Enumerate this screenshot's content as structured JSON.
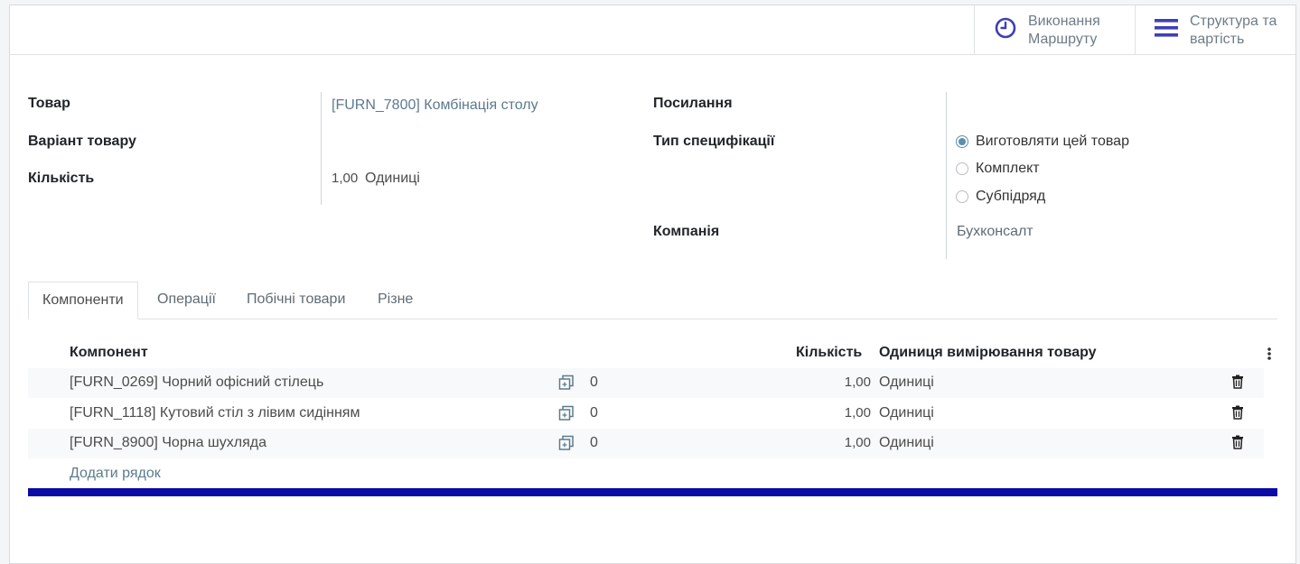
{
  "buttons": {
    "routing": {
      "label": "Виконання\nМаршруту",
      "icon": "clock-icon"
    },
    "structure": {
      "label": "Структура та\nвартість",
      "icon": "bars-icon"
    }
  },
  "fields": {
    "product": {
      "label": "Товар",
      "value": "[FURN_7800] Комбінація столу"
    },
    "variant": {
      "label": "Варіант товару",
      "value": ""
    },
    "quantity": {
      "label": "Кількість",
      "value": "1,00",
      "uom": "Одиниці"
    },
    "reference": {
      "label": "Посилання",
      "value": ""
    },
    "bom_type": {
      "label": "Тип специфікації",
      "options": [
        "Виготовляти цей товар",
        "Комплект",
        "Субпідряд"
      ],
      "selected": "Виготовляти цей товар"
    },
    "company": {
      "label": "Компанія",
      "value": "Бухконсалт"
    }
  },
  "tabs": [
    "Компоненти",
    "Операції",
    "Побічні товари",
    "Різне"
  ],
  "active_tab": "Компоненти",
  "table": {
    "columns": [
      "Компонент",
      "Кількість",
      "Одиниця вимірювання товару"
    ],
    "rows": [
      {
        "component": "[FURN_0269] Чорний офісний стілець",
        "count": "0",
        "qty": "1,00",
        "uom": "Одиниці"
      },
      {
        "component": "[FURN_1118] Кутовий стіл з лівим сидінням",
        "count": "0",
        "qty": "1,00",
        "uom": "Одиниці"
      },
      {
        "component": "[FURN_8900] Чорна шухляда",
        "count": "0",
        "qty": "1,00",
        "uom": "Одиниці"
      }
    ],
    "add_line": "Додати рядок"
  },
  "colors": {
    "accent": "#5c7a8e",
    "icon_blue": "#3f3fb5",
    "bottom_bar": "#0a0aa6"
  }
}
